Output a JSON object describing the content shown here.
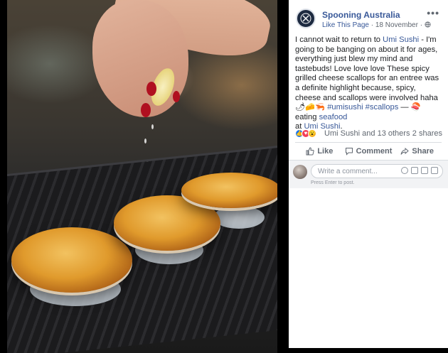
{
  "post": {
    "page_name": "Spooning Australia",
    "like_this_page": "Like This Page",
    "separator": "·",
    "date": "18 November",
    "separator2": "·",
    "more": "•••",
    "text": {
      "part1": "I cannot wait to return to ",
      "link1": "Umi Sushi",
      "part2": " - I'm going to be banging on about it for ages, everything just blew my mind and tastebuds! Love love love These spicy grilled cheese scallops for an entree was a definite highlight because, spicy, cheese and scallops were involved haha",
      "hashtags": "#umisushi #scallops",
      "dash": " — ",
      "eating": "eating ",
      "link2": "seafood",
      "at": " at ",
      "link3": "Umi Sushi",
      "end": "."
    }
  },
  "reactions": {
    "count_text": "Umi Sushi and 13 others",
    "shares": "2 shares"
  },
  "actions": {
    "like": "Like",
    "comment": "Comment",
    "share": "Share"
  },
  "comment_box": {
    "placeholder": "Write a comment...",
    "hint": "Press Enter to post."
  },
  "colors": {
    "link": "#385898",
    "meta": "#606770",
    "like_blue": "#1877f2",
    "love_red": "#f33e58",
    "wow_yellow": "#f7b125"
  }
}
